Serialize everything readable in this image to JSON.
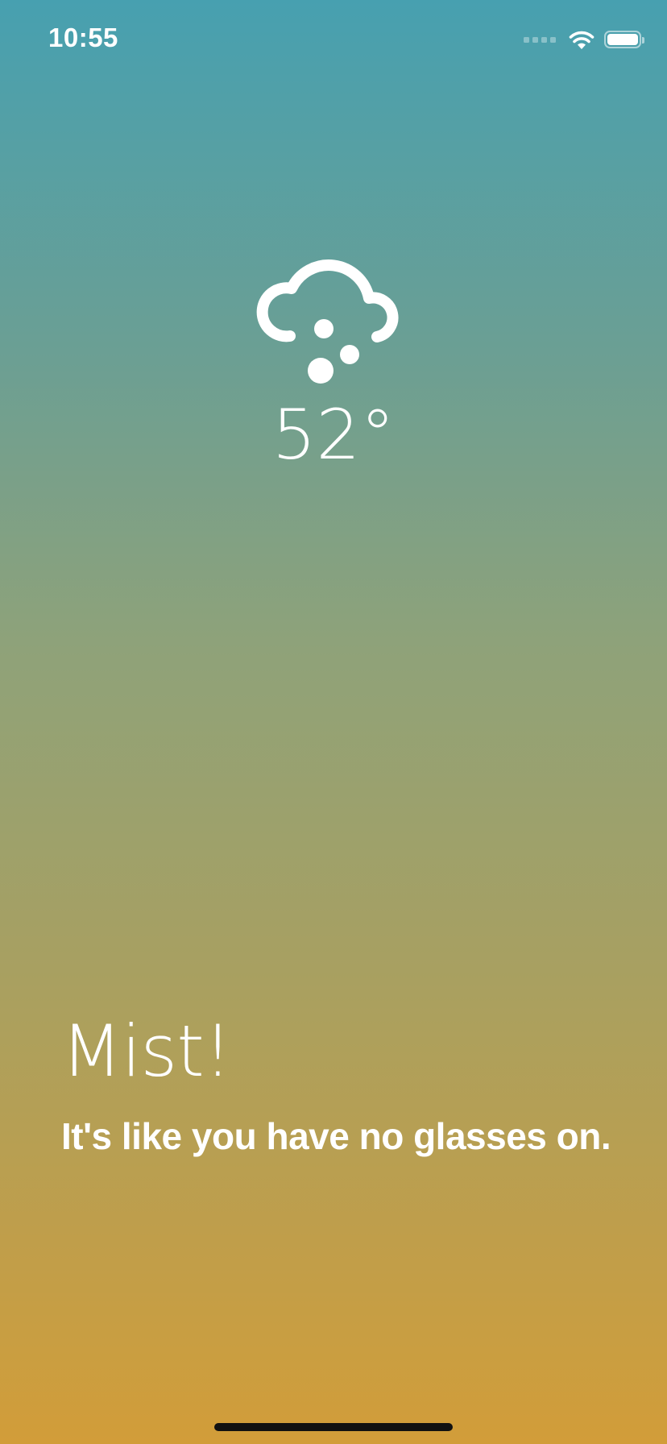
{
  "status_bar": {
    "time": "10:55",
    "signal_icon": "cellular-signal-icon",
    "wifi_icon": "wifi-icon",
    "battery_icon": "battery-icon",
    "battery_level": 1.0
  },
  "weather": {
    "icon": "cloud-hail-icon",
    "temperature": "52°"
  },
  "message": {
    "headline": "Mist!",
    "subtitle": "It's like you have no glasses on."
  },
  "colors": {
    "gradient_top": "#47a0b0",
    "gradient_bottom": "#d29d39",
    "text": "#ffffff"
  }
}
